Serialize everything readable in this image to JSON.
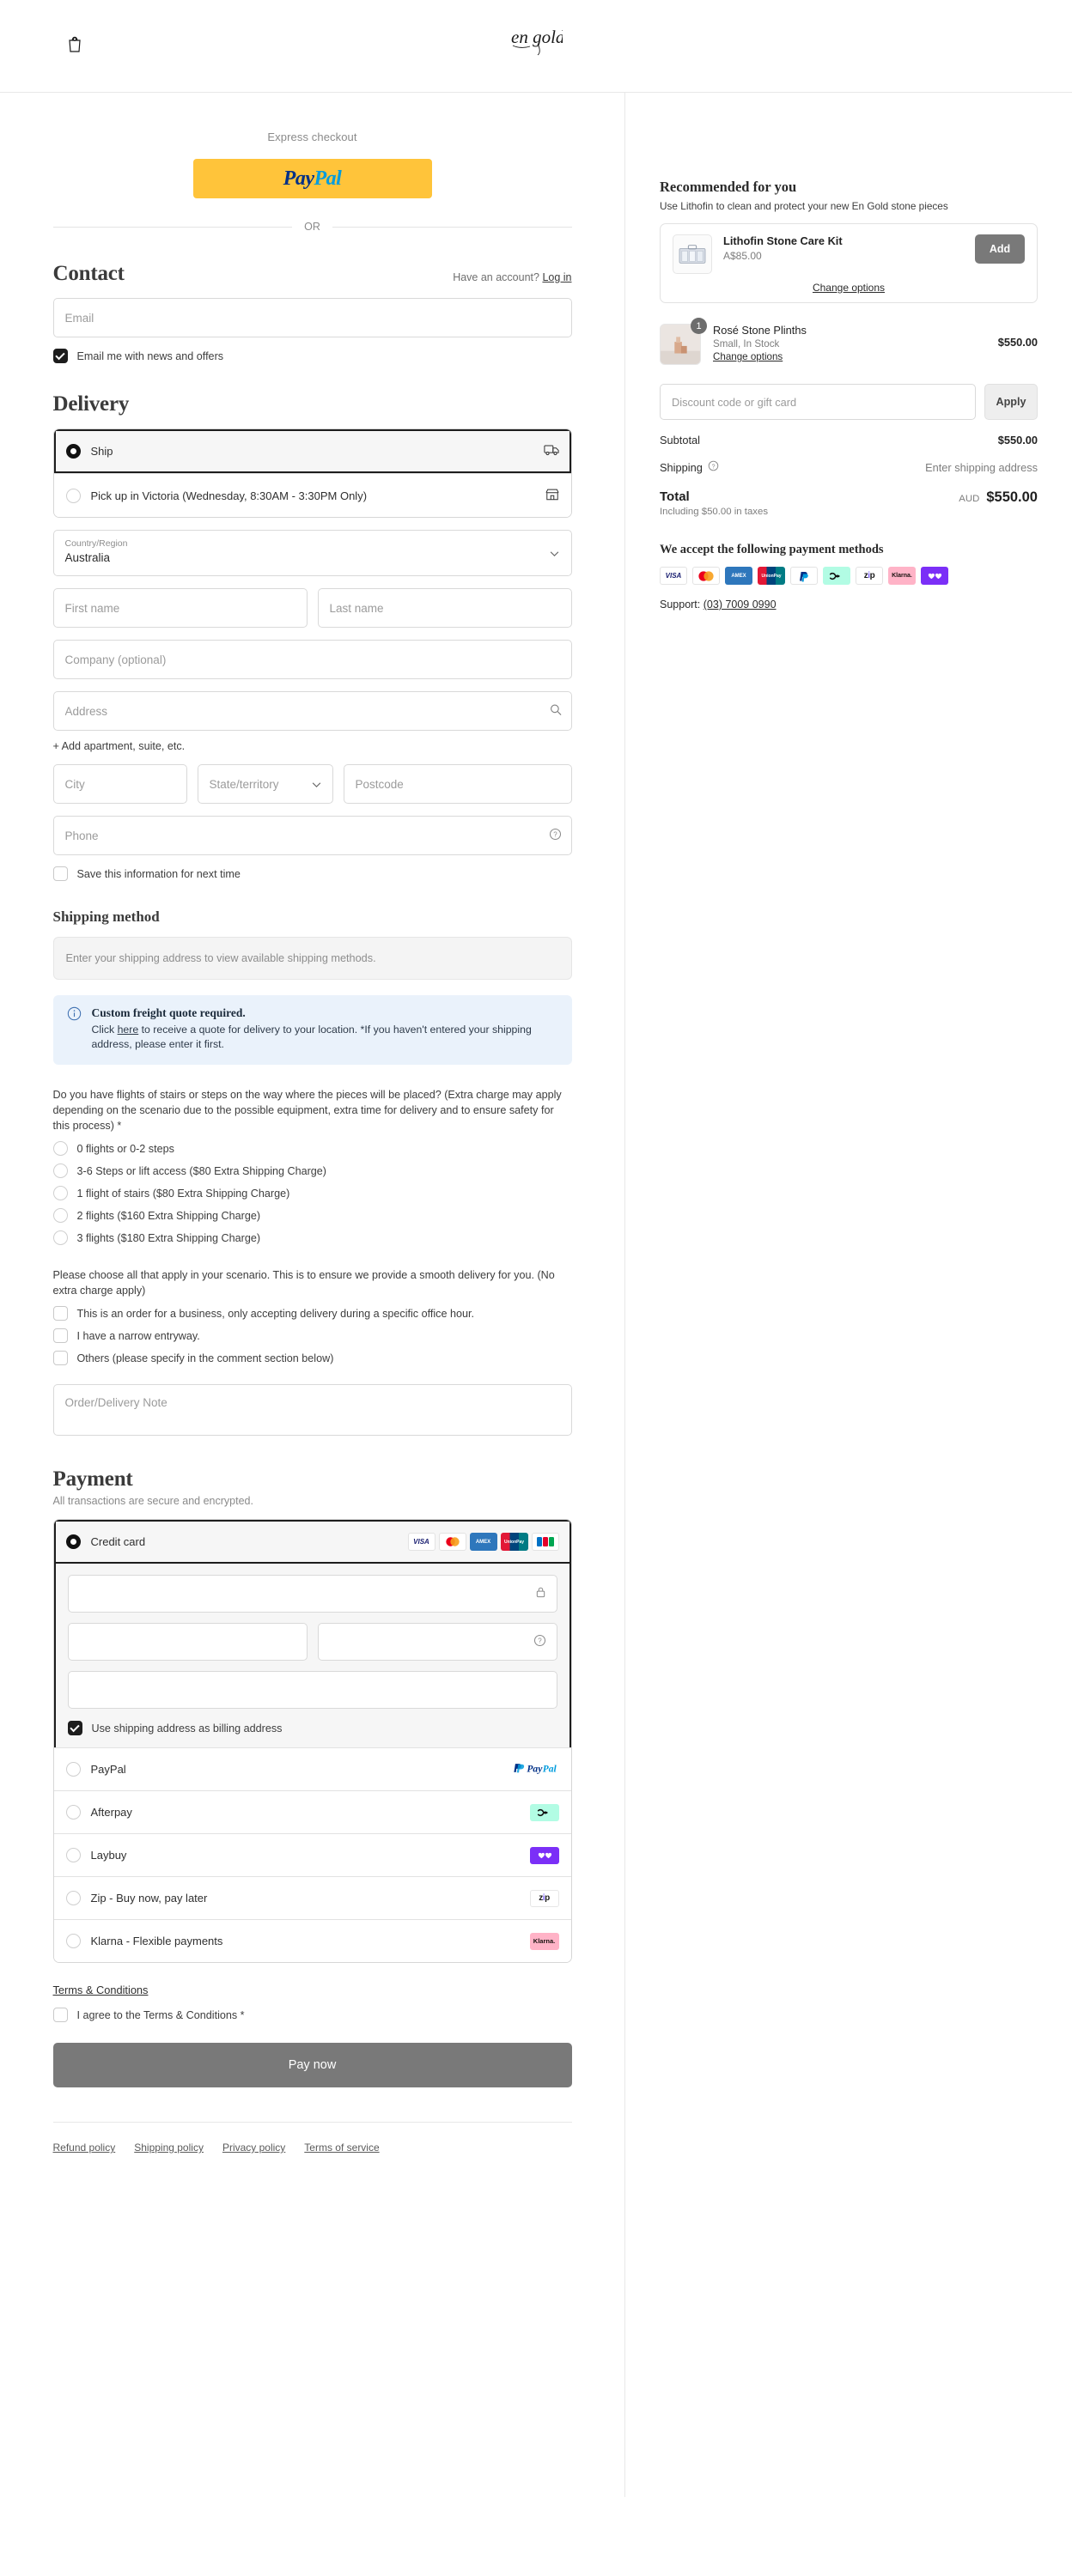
{
  "header": {
    "logo_text": "en gold.",
    "bag_icon": "shopping-bag-icon"
  },
  "express": {
    "label": "Express checkout",
    "paypal_a": "Pay",
    "paypal_b": "Pal",
    "or": "OR"
  },
  "contact": {
    "title": "Contact",
    "account_prefix": "Have an account?",
    "login_label": "Log in",
    "email_placeholder": "Email",
    "newsletter_label": "Email me with news and offers",
    "newsletter_checked": true
  },
  "delivery": {
    "title": "Delivery",
    "options": [
      {
        "label": "Ship",
        "selected": true,
        "icon": "truck-icon"
      },
      {
        "label": "Pick up in Victoria (Wednesday, 8:30AM - 3:30PM Only)",
        "selected": false,
        "icon": "store-icon"
      }
    ],
    "country_label": "Country/Region",
    "country_value": "Australia",
    "first_name_placeholder": "First name",
    "last_name_placeholder": "Last name",
    "company_placeholder": "Company (optional)",
    "address_placeholder": "Address",
    "add_apartment": "+ Add apartment, suite, etc.",
    "city_placeholder": "City",
    "state_placeholder": "State/territory",
    "postcode_placeholder": "Postcode",
    "phone_placeholder": "Phone",
    "save_info_label": "Save this information for next time",
    "save_info_checked": false
  },
  "shipping_method": {
    "title": "Shipping method",
    "empty_text": "Enter your shipping address to view available shipping methods."
  },
  "banner": {
    "icon": "info-icon",
    "title": "Custom freight quote required.",
    "body_part1": "Click ",
    "link": "here",
    "body_part2": " to receive a quote for delivery to your location. *If you haven't entered your shipping address, please enter it first."
  },
  "stairs_question": {
    "text": "Do you have flights of stairs or steps on the way where the pieces will be placed? (Extra charge may apply depending on the scenario due to the possible equipment, extra time for delivery and to ensure safety for this process) *",
    "options": [
      {
        "label": "0 flights or 0-2 steps",
        "selected": false
      },
      {
        "label": "3-6 Steps or lift access ($80 Extra Shipping Charge)",
        "selected": false
      },
      {
        "label": "1 flight of stairs ($80 Extra Shipping Charge)",
        "selected": false
      },
      {
        "label": "2 flights ($160 Extra Shipping Charge)",
        "selected": false
      },
      {
        "label": "3 flights ($180 Extra Shipping Charge)",
        "selected": false
      }
    ]
  },
  "scenario_question": {
    "text": "Please choose all that apply in your scenario. This is to ensure we provide a smooth delivery for you. (No extra charge apply)",
    "options": [
      {
        "label": "This is an order for a business, only accepting delivery during a specific office hour.",
        "checked": false
      },
      {
        "label": "I have a narrow entryway.",
        "checked": false
      },
      {
        "label": "Others (please specify in the comment section below)",
        "checked": false
      }
    ]
  },
  "note": {
    "placeholder": "Order/Delivery Note"
  },
  "payment": {
    "title": "Payment",
    "subtitle": "All transactions are secure and encrypted.",
    "credit_card_label": "Credit card",
    "card_logos": [
      "VISA",
      "mastercard",
      "AMEX",
      "UnionPay",
      "JCB"
    ],
    "card_number_placeholder": "",
    "expiry_placeholder": "",
    "cvv_placeholder": "",
    "name_on_card_placeholder": "",
    "billing_label": "Use shipping address as billing address",
    "billing_checked": true,
    "methods": [
      {
        "label": "PayPal",
        "logo": "paypal"
      },
      {
        "label": "Afterpay",
        "logo": "afterpay"
      },
      {
        "label": "Laybuy",
        "logo": "laybuy"
      },
      {
        "label": "Zip - Buy now, pay later",
        "logo": "zip"
      },
      {
        "label": "Klarna - Flexible payments",
        "logo": "klarna"
      }
    ]
  },
  "terms": {
    "link_label": "Terms & Conditions",
    "agree_label": "I agree to the Terms & Conditions *",
    "agree_checked": false
  },
  "pay_now_label": "Pay now",
  "footer": {
    "links": [
      "Refund policy",
      "Shipping policy",
      "Privacy policy",
      "Terms of service"
    ]
  },
  "recommended": {
    "title": "Recommended for you",
    "subtitle": "Use Lithofin to clean and protect your new En Gold stone pieces",
    "product_name": "Lithofin Stone Care Kit",
    "product_price": "A$85.00",
    "add_label": "Add",
    "change_options_label": "Change options"
  },
  "cart": {
    "item_name": "Rosé Stone Plinths",
    "item_variant": "Small, In Stock",
    "item_change": "Change options",
    "item_price": "$550.00",
    "qty": "1",
    "discount_placeholder": "Discount code or gift card",
    "apply_label": "Apply"
  },
  "summary": {
    "subtotal_label": "Subtotal",
    "subtotal_value": "$550.00",
    "shipping_label": "Shipping",
    "shipping_value": "Enter shipping address",
    "total_label": "Total",
    "total_note": "Including $50.00 in taxes",
    "currency": "AUD",
    "total_value": "$550.00"
  },
  "accepted": {
    "title": "We accept the following payment methods",
    "methods": [
      "VISA",
      "mastercard",
      "AMEX",
      "UnionPay",
      "PayPal",
      "Afterpay",
      "Zip",
      "Klarna",
      "Laybuy"
    ],
    "support_prefix": "Support:",
    "support_phone": "(03) 7009 0990"
  },
  "colors": {
    "paypal_yellow": "#ffc43a",
    "banner_blue": "#eaf2fb",
    "pay_button": "#797979"
  }
}
